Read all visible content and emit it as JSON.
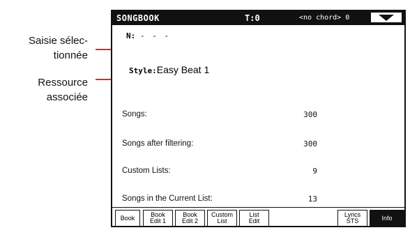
{
  "callouts": {
    "selected_entry": "Saisie sélec-\ntionnée",
    "associated_resource": "Ressource\nassociée"
  },
  "header": {
    "title": "SONGBOOK",
    "tempo": "T:0",
    "chord": "<no chord> 0",
    "menu_icon": "triangle-down-icon"
  },
  "entry": {
    "label": "N:",
    "value": "- - -"
  },
  "style": {
    "label": "Style:",
    "value": "Easy Beat 1"
  },
  "info": [
    {
      "label": "Songs:",
      "value": "300"
    },
    {
      "label": "Songs after filtering:",
      "value": "300"
    },
    {
      "label": "Custom Lists:",
      "value": "9"
    },
    {
      "label": "Songs in the Current List:",
      "value": "13"
    }
  ],
  "tabs": [
    {
      "label": "Book",
      "active": false
    },
    {
      "label": "Book\nEdit 1",
      "active": false
    },
    {
      "label": "Book\nEdit 2",
      "active": false
    },
    {
      "label": "Custom\nList",
      "active": false
    },
    {
      "label": "List\nEdit",
      "active": false
    },
    {
      "label": "Lyrics\nSTS",
      "active": false
    },
    {
      "label": "Info",
      "active": true
    }
  ],
  "colors": {
    "callout": "#e8232a",
    "screen": "#111111"
  }
}
